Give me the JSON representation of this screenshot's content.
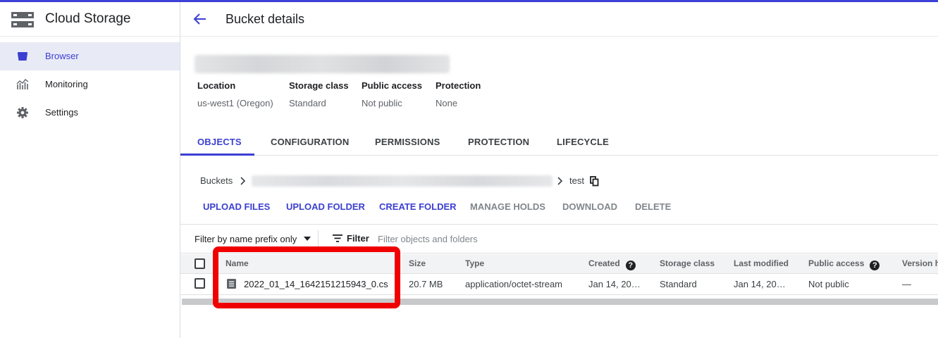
{
  "app": {
    "title": "Cloud Storage"
  },
  "sidebar": {
    "items": [
      {
        "label": "Browser",
        "icon": "bucket-icon",
        "active": true
      },
      {
        "label": "Monitoring",
        "icon": "chart-icon",
        "active": false
      },
      {
        "label": "Settings",
        "icon": "gear-icon",
        "active": false
      }
    ]
  },
  "header": {
    "title": "Bucket details",
    "back_icon": "arrow-left-icon"
  },
  "bucket": {
    "info": {
      "location_label": "Location",
      "location_value": "us-west1 (Oregon)",
      "class_label": "Storage class",
      "class_value": "Standard",
      "access_label": "Public access",
      "access_value": "Not public",
      "protection_label": "Protection",
      "protection_value": "None"
    }
  },
  "tabs": [
    "OBJECTS",
    "CONFIGURATION",
    "PERMISSIONS",
    "PROTECTION",
    "LIFECYCLE"
  ],
  "breadcrumb": {
    "root": "Buckets",
    "current": "test",
    "copy_icon": "copy-icon"
  },
  "actions": {
    "upload_files": "UPLOAD FILES",
    "upload_folder": "UPLOAD FOLDER",
    "create_folder": "CREATE FOLDER",
    "manage_holds": "MANAGE HOLDS",
    "download": "DOWNLOAD",
    "delete": "DELETE"
  },
  "filter": {
    "mode": "Filter by name prefix only",
    "button": "Filter",
    "placeholder": "Filter objects and folders"
  },
  "table": {
    "columns": {
      "name": "Name",
      "size": "Size",
      "type": "Type",
      "created": "Created",
      "storage_class": "Storage class",
      "last_modified": "Last modified",
      "public_access": "Public access",
      "version": "Version h"
    },
    "rows": [
      {
        "name": "2022_01_14_1642151215943_0.cs",
        "size": "20.7 MB",
        "type": "application/octet-stream",
        "created": "Jan 14, 20…",
        "storage_class": "Standard",
        "last_modified": "Jan 14, 20…",
        "public_access": "Not public",
        "version": "—"
      }
    ]
  },
  "colors": {
    "accent": "#3b3fd1",
    "highlight": "#f00000"
  }
}
